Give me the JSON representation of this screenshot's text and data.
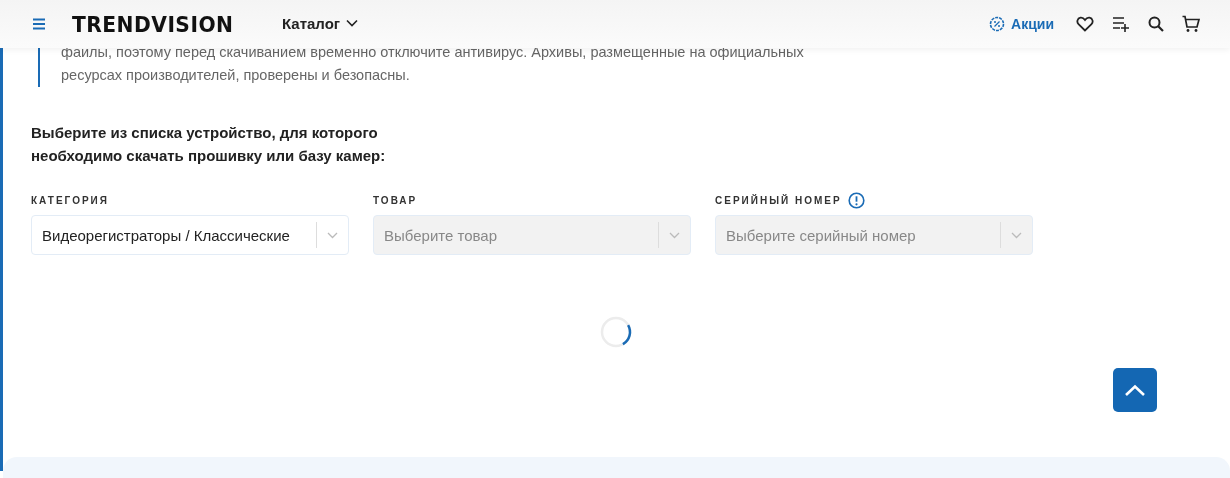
{
  "header": {
    "logo": "TRENDVISION",
    "catalog": "Каталог",
    "promo": "Акции"
  },
  "notice": {
    "lines": [
      "файлы, поэтому перед скачиванием временно отключите антивирус. Архивы, размещенные на официальных",
      "ресурсах производителей, проверены и безопасны."
    ]
  },
  "prompt": "Выберите из списка устройство, для которого необходимо скачать прошивку или базу камер:",
  "selects": [
    {
      "label": "КАТЕГОРИЯ",
      "value": "Видеорегистраторы / Классические",
      "disabled": false,
      "info": false
    },
    {
      "label": "ТОВАР",
      "placeholder": "Выберите товар",
      "disabled": true,
      "info": false
    },
    {
      "label": "СЕРИЙНЫЙ НОМЕР",
      "placeholder": "Выберите серийный номер",
      "disabled": true,
      "info": true
    }
  ]
}
